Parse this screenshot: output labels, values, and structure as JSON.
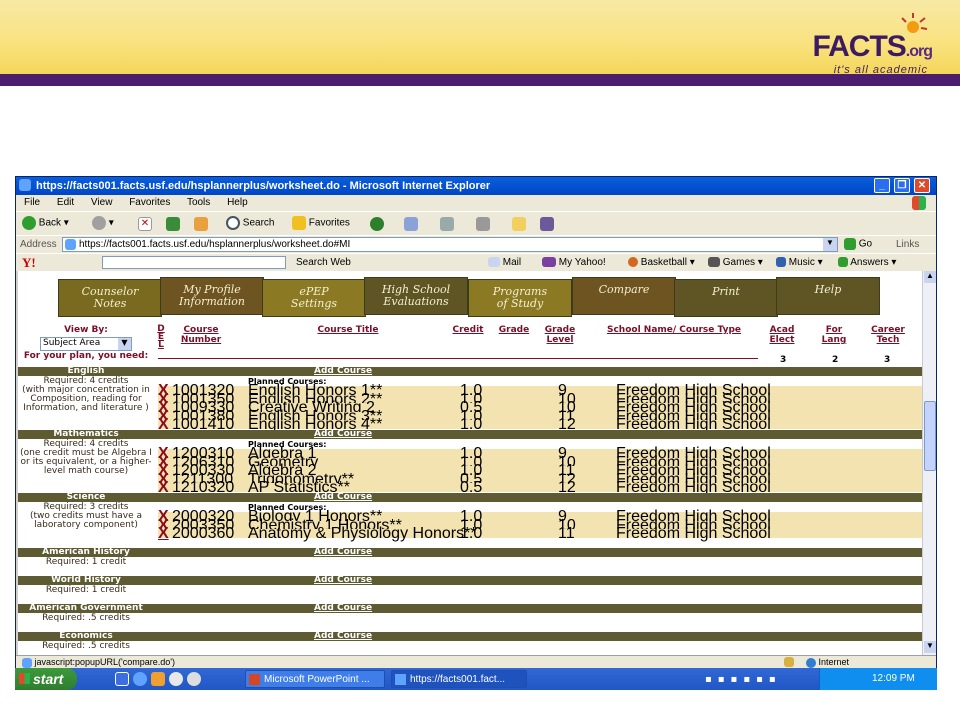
{
  "branding": {
    "logo": "FACTS",
    "logo_suffix": ".org",
    "tagline": "it's all academic"
  },
  "browser": {
    "title": "https://facts001.facts.usf.edu/hsplannerplus/worksheet.do - Microsoft Internet Explorer",
    "menu": [
      "File",
      "Edit",
      "View",
      "Favorites",
      "Tools",
      "Help"
    ],
    "toolbar": {
      "back": "Back",
      "search": "Search",
      "favorites": "Favorites"
    },
    "address_label": "Address",
    "address": "https://facts001.facts.usf.edu/hsplannerplus/worksheet.do#MI",
    "go": "Go",
    "links": "Links",
    "yahoo": {
      "logo": "Y!",
      "search_web": "Search Web",
      "items": [
        "Mail",
        "My Yahoo!",
        "Basketball",
        "Games",
        "Music",
        "Answers"
      ]
    },
    "status": "javascript:popupURL('compare.do')",
    "zone": "Internet"
  },
  "tabs": [
    {
      "line1": "Counselor",
      "line2": "Notes"
    },
    {
      "line1": "My Profile",
      "line2": "Information"
    },
    {
      "line1": "ePEP",
      "line2": "Settings"
    },
    {
      "line1": "High School",
      "line2": "Evaluations"
    },
    {
      "line1": "Programs",
      "line2": "of Study"
    },
    {
      "line1": "Compare",
      "line2": ""
    },
    {
      "line1": "Print",
      "line2": ""
    },
    {
      "line1": "Help",
      "line2": ""
    }
  ],
  "worksheet": {
    "view_by_label": "View By:",
    "view_by_value": "Subject Area",
    "headers": {
      "del": "D E L",
      "course_number": "Course Number",
      "course_title": "Course Title",
      "credit": "Credit",
      "grade": "Grade",
      "grade_level": "Grade Level",
      "school": "School Name/ Course Type",
      "acad": "Acad Elect",
      "for_lang": "For Lang",
      "career": "Career Tech"
    },
    "plan_label": "For your plan, you need:",
    "needs": {
      "acad": "3",
      "for_lang": "2",
      "career": "3"
    },
    "add_course": "Add Course",
    "planned_label": "Planned Courses:",
    "del_mark": "X",
    "subjects": [
      {
        "name": "English",
        "req": "Required: 4 credits",
        "note": "(with major concentration in Composition, reading for Information, and literature )",
        "courses": [
          {
            "num": "1001320",
            "title": "English Honors 1**",
            "credit": "1.0",
            "level": "9",
            "school": "Freedom High School"
          },
          {
            "num": "1001350",
            "title": "English Honors 2**",
            "credit": "1.0",
            "level": "10",
            "school": "Freedom High School"
          },
          {
            "num": "1009330",
            "title": "Creative Writing 2",
            "credit": "0.5",
            "level": "10",
            "school": "Freedom High School"
          },
          {
            "num": "1001380",
            "title": "English Honors 3**",
            "credit": "1.0",
            "level": "11",
            "school": "Freedom High School"
          },
          {
            "num": "1001410",
            "title": "English Honors 4**",
            "credit": "1.0",
            "level": "12",
            "school": "Freedom High School"
          }
        ]
      },
      {
        "name": "Mathematics",
        "req": "Required: 4 credits",
        "note": "(one credit must be Algebra I or its equivalent, or a higher-level math course)",
        "courses": [
          {
            "num": "1200310",
            "title": "Algebra 1",
            "credit": "1.0",
            "level": "9",
            "school": "Freedom High School"
          },
          {
            "num": "1206310",
            "title": "Geometry",
            "credit": "1.0",
            "level": "10",
            "school": "Freedom High School"
          },
          {
            "num": "1200330",
            "title": "Algebra 2",
            "credit": "1.0",
            "level": "11",
            "school": "Freedom High School"
          },
          {
            "num": "1211300",
            "title": "Trigonometry**",
            "credit": "0.5",
            "level": "12",
            "school": "Freedom High School"
          },
          {
            "num": "1210320",
            "title": "AP Statistics**",
            "credit": "0.5",
            "level": "12",
            "school": "Freedom High School"
          }
        ]
      },
      {
        "name": "Science",
        "req": "Required: 3 credits",
        "note": "(two credits must have a laboratory component)",
        "courses": [
          {
            "num": "2000320",
            "title": "Biology 1 Honors**",
            "credit": "1.0",
            "level": "9",
            "school": "Freedom High School"
          },
          {
            "num": "2003350",
            "title": "Chemistry 1 Honors**",
            "credit": "1.0",
            "level": "10",
            "school": "Freedom High School"
          },
          {
            "num": "2000360",
            "title": "Anatomy & Physiology Honors**",
            "credit": "1.0",
            "level": "11",
            "school": "Freedom High School"
          }
        ]
      },
      {
        "name": "American History",
        "req": "Required: 1 credit",
        "note": "",
        "courses": []
      },
      {
        "name": "World History",
        "req": "Required: 1 credit",
        "note": "",
        "courses": []
      },
      {
        "name": "American Government",
        "req": "Required: .5 credits",
        "note": "",
        "courses": []
      },
      {
        "name": "Economics",
        "req": "Required: .5 credits",
        "note": "",
        "courses": []
      }
    ]
  },
  "taskbar": {
    "start": "start",
    "items": [
      "Microsoft PowerPoint ...",
      "https://facts001.fact..."
    ],
    "clock": "12:09 PM"
  }
}
